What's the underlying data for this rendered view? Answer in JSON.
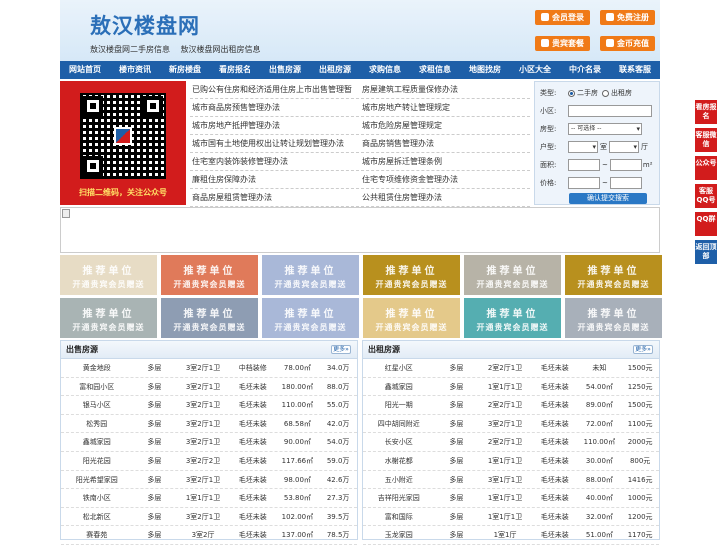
{
  "header": {
    "logo": "敖汉楼盘网",
    "sublinks": [
      "敖汉楼盘网二手房信息",
      "敖汉楼盘网出租房信息"
    ],
    "buttons": [
      "会员登录",
      "免费注册",
      "贵宾套餐",
      "金币充值"
    ]
  },
  "nav": [
    "网站首页",
    "楼市资讯",
    "新房楼盘",
    "看房报名",
    "出售房源",
    "出租房源",
    "求购信息",
    "求租信息",
    "地图找房",
    "小区大全",
    "中介名录",
    "联系客服"
  ],
  "qr_caption": "扫描二维码，关注公众号",
  "news": [
    [
      "已购公有住房和经济适用住房上市出售管理暂",
      "房屋建筑工程质量保修办法"
    ],
    [
      "城市商品房预售管理办法",
      "城市房地产转让管理规定"
    ],
    [
      "城市房地产抵押管理办法",
      "城市危险房屋管理规定"
    ],
    [
      "城市国有土地使用权出让转让规划管理办法",
      "商品房销售管理办法"
    ],
    [
      "住宅室内装饰装修管理办法",
      "城市房屋拆迁管理条例"
    ],
    [
      "廉租住房保障办法",
      "住宅专项维修资金管理办法"
    ],
    [
      "商品房屋租赁管理办法",
      "公共租赁住房管理办法"
    ]
  ],
  "search": {
    "type_label": "类型:",
    "type_options": [
      "二手房",
      "出租房"
    ],
    "community_label": "小区:",
    "housetype_label": "房型:",
    "housetype_value": "-- 可选择 --",
    "layout_label": "户型:",
    "room_unit": "室",
    "hall_unit": "厅",
    "area_label": "面积:",
    "area_unit": "m²",
    "price_label": "价格:",
    "price_sep": "~",
    "submit": "确认提交搜索"
  },
  "ads": {
    "line1": "推荐单位",
    "line2": "开通贵宾会员赠送",
    "colors": [
      "#e7dcc5",
      "#e07a5a",
      "#a9b8d8",
      "#b8901e",
      "#b7b3a7",
      "#b8901e",
      "#a9b4b4",
      "#8e9db3",
      "#a9b8d8",
      "#e4c98a",
      "#55aeb1",
      "#a8b0ba"
    ]
  },
  "sale": {
    "title": "出售房源",
    "more": "更多»",
    "rows": [
      [
        "黄金地段",
        "多层",
        "3室2厅1卫",
        "中档装修",
        "78.00㎡",
        "34.0万"
      ],
      [
        "富和园小区",
        "多层",
        "3室2厅1卫",
        "毛坯未装",
        "180.00㎡",
        "88.0万"
      ],
      [
        "银马小区",
        "多层",
        "3室2厅1卫",
        "毛坯未装",
        "110.00㎡",
        "55.0万"
      ],
      [
        "松秀园",
        "多层",
        "3室2厅1卫",
        "毛坯未装",
        "68.58㎡",
        "42.0万"
      ],
      [
        "鑫城家园",
        "多层",
        "3室2厅1卫",
        "毛坯未装",
        "90.00㎡",
        "54.0万"
      ],
      [
        "阳光花园",
        "多层",
        "3室2厅2卫",
        "毛坯未装",
        "117.66㎡",
        "59.0万"
      ],
      [
        "阳光希望家园",
        "多层",
        "3室2厅1卫",
        "毛坯未装",
        "98.00㎡",
        "42.6万"
      ],
      [
        "铁南小区",
        "多层",
        "1室1厅1卫",
        "毛坯未装",
        "53.80㎡",
        "27.3万"
      ],
      [
        "松北新区",
        "多层",
        "3室2厅1卫",
        "毛坯未装",
        "102.00㎡",
        "39.5万"
      ],
      [
        "赛春苑",
        "多层",
        "3室2厅",
        "毛坯未装",
        "137.00㎡",
        "78.5万"
      ]
    ]
  },
  "rent": {
    "title": "出租房源",
    "more": "更多»",
    "rows": [
      [
        "红星小区",
        "多层",
        "2室2厅1卫",
        "毛坯未装",
        "未知",
        "1500元"
      ],
      [
        "鑫城家园",
        "多层",
        "1室1厅1卫",
        "毛坯未装",
        "54.00㎡",
        "1250元"
      ],
      [
        "阳光一期",
        "多层",
        "2室2厅1卫",
        "毛坯未装",
        "89.00㎡",
        "1500元"
      ],
      [
        "四中胡同附近",
        "多层",
        "3室2厅1卫",
        "毛坯未装",
        "72.00㎡",
        "1100元"
      ],
      [
        "长安小区",
        "多层",
        "2室2厅1卫",
        "毛坯未装",
        "110.00㎡",
        "2000元"
      ],
      [
        "水榭花都",
        "多层",
        "1室1厅1卫",
        "毛坯未装",
        "30.00㎡",
        "800元"
      ],
      [
        "五小附近",
        "多层",
        "3室1厅1卫",
        "毛坯未装",
        "88.00㎡",
        "1416元"
      ],
      [
        "吉祥阳光家园",
        "多层",
        "1室1厅1卫",
        "毛坯未装",
        "40.00㎡",
        "1000元"
      ],
      [
        "富和国际",
        "多层",
        "1室1厅1卫",
        "毛坯未装",
        "32.00㎡",
        "1200元"
      ],
      [
        "玉龙家园",
        "多层",
        "1室1厅",
        "毛坯未装",
        "51.00㎡",
        "1170元"
      ]
    ]
  },
  "side": [
    "看房报名",
    "客服微信",
    "公众号",
    "客服QQ号",
    "QQ群",
    "返回顶部"
  ]
}
